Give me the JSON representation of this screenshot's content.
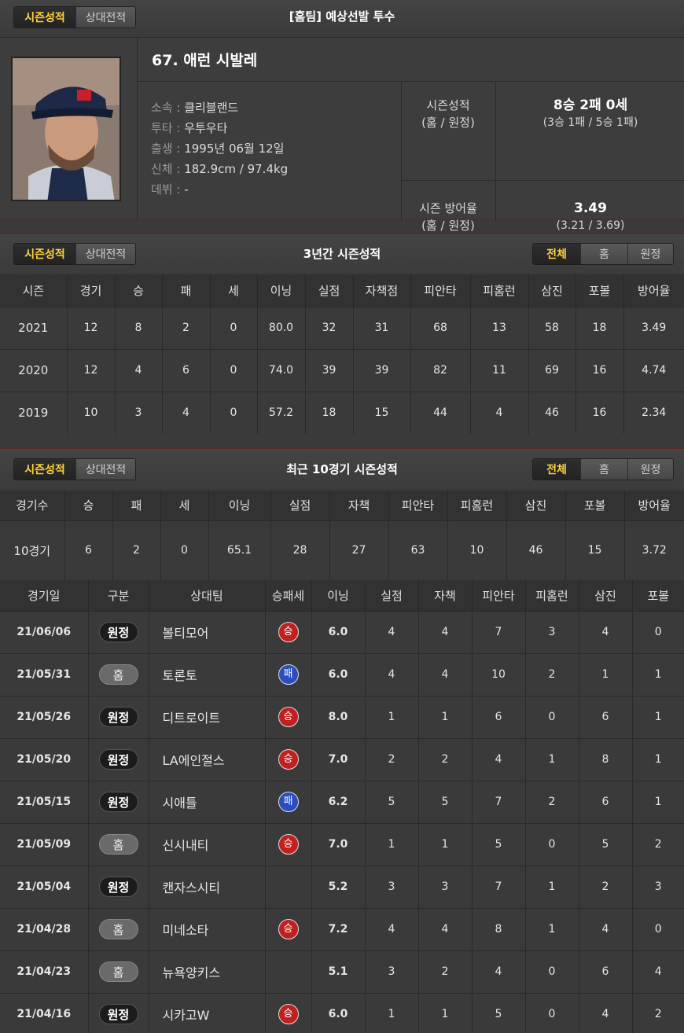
{
  "tabs": [
    "시즌성적",
    "상대전적"
  ],
  "filters": [
    "전체",
    "홈",
    "원정"
  ],
  "header_title": "[홈팀] 예상선발 투수",
  "player": {
    "name": "67. 애런 시발레",
    "info": [
      {
        "k": "소속",
        "v": "클리블랜드"
      },
      {
        "k": "투타",
        "v": "우투우타"
      },
      {
        "k": "출생",
        "v": "1995년 06월 12일"
      },
      {
        "k": "신체",
        "v": "182.9cm / 97.4kg"
      },
      {
        "k": "데뷔",
        "v": "-"
      }
    ],
    "record_label_1": "시즌성적",
    "record_label_2": "(홈 / 원정)",
    "record_main": "8승 2패 0세",
    "record_split": "(3승 1패 / 5승 1패)",
    "era_label_1": "시즌 방어율",
    "era_label_2": "(홈 / 원정)",
    "era_main": "3.49",
    "era_split": "(3.21 / 3.69)"
  },
  "season_section": {
    "title": "3년간 시즌성적",
    "headers": [
      "시즌",
      "경기",
      "승",
      "패",
      "세",
      "이닝",
      "실점",
      "자책점",
      "피안타",
      "피홈런",
      "삼진",
      "포볼",
      "방어율"
    ],
    "rows": [
      [
        "2021",
        "12",
        "8",
        "2",
        "0",
        "80.0",
        "32",
        "31",
        "68",
        "13",
        "58",
        "18",
        "3.49"
      ],
      [
        "2020",
        "12",
        "4",
        "6",
        "0",
        "74.0",
        "39",
        "39",
        "82",
        "11",
        "69",
        "16",
        "4.74"
      ],
      [
        "2019",
        "10",
        "3",
        "4",
        "0",
        "57.2",
        "18",
        "15",
        "44",
        "4",
        "46",
        "16",
        "2.34"
      ]
    ]
  },
  "recent_section": {
    "title": "최근 10경기 시즌성적",
    "headers": [
      "경기수",
      "승",
      "패",
      "세",
      "이닝",
      "실점",
      "자책",
      "피안타",
      "피홈런",
      "삼진",
      "포볼",
      "방어율"
    ],
    "row": [
      "10경기",
      "6",
      "2",
      "0",
      "65.1",
      "28",
      "27",
      "63",
      "10",
      "46",
      "15",
      "3.72"
    ]
  },
  "game_log": {
    "headers": [
      "경기일",
      "구분",
      "상대팀",
      "승패세",
      "이닝",
      "실점",
      "자책",
      "피안타",
      "피홈런",
      "삼진",
      "포볼"
    ],
    "rows": [
      {
        "date": "21/06/06",
        "loc": "원정",
        "opp": "볼티모어",
        "res": "승",
        "ip": "6.0",
        "r": "4",
        "er": "4",
        "h": "7",
        "hr": "3",
        "so": "4",
        "bb": "0"
      },
      {
        "date": "21/05/31",
        "loc": "홈",
        "opp": "토론토",
        "res": "패",
        "ip": "6.0",
        "r": "4",
        "er": "4",
        "h": "10",
        "hr": "2",
        "so": "1",
        "bb": "1"
      },
      {
        "date": "21/05/26",
        "loc": "원정",
        "opp": "디트로이트",
        "res": "승",
        "ip": "8.0",
        "r": "1",
        "er": "1",
        "h": "6",
        "hr": "0",
        "so": "6",
        "bb": "1"
      },
      {
        "date": "21/05/20",
        "loc": "원정",
        "opp": "LA에인절스",
        "res": "승",
        "ip": "7.0",
        "r": "2",
        "er": "2",
        "h": "4",
        "hr": "1",
        "so": "8",
        "bb": "1"
      },
      {
        "date": "21/05/15",
        "loc": "원정",
        "opp": "시애틀",
        "res": "패",
        "ip": "6.2",
        "r": "5",
        "er": "5",
        "h": "7",
        "hr": "2",
        "so": "6",
        "bb": "1"
      },
      {
        "date": "21/05/09",
        "loc": "홈",
        "opp": "신시내티",
        "res": "승",
        "ip": "7.0",
        "r": "1",
        "er": "1",
        "h": "5",
        "hr": "0",
        "so": "5",
        "bb": "2"
      },
      {
        "date": "21/05/04",
        "loc": "원정",
        "opp": "캔자스시티",
        "res": "",
        "ip": "5.2",
        "r": "3",
        "er": "3",
        "h": "7",
        "hr": "1",
        "so": "2",
        "bb": "3"
      },
      {
        "date": "21/04/28",
        "loc": "홈",
        "opp": "미네소타",
        "res": "승",
        "ip": "7.2",
        "r": "4",
        "er": "4",
        "h": "8",
        "hr": "1",
        "so": "4",
        "bb": "0"
      },
      {
        "date": "21/04/23",
        "loc": "홈",
        "opp": "뉴욕양키스",
        "res": "",
        "ip": "5.1",
        "r": "3",
        "er": "2",
        "h": "4",
        "hr": "0",
        "so": "6",
        "bb": "4"
      },
      {
        "date": "21/04/16",
        "loc": "원정",
        "opp": "시카고W",
        "res": "승",
        "ip": "6.0",
        "r": "1",
        "er": "1",
        "h": "5",
        "hr": "0",
        "so": "4",
        "bb": "2"
      }
    ]
  },
  "colors": {
    "active_tab": "#ffd23a",
    "win": "#c0201f",
    "loss": "#2a4ec0"
  }
}
